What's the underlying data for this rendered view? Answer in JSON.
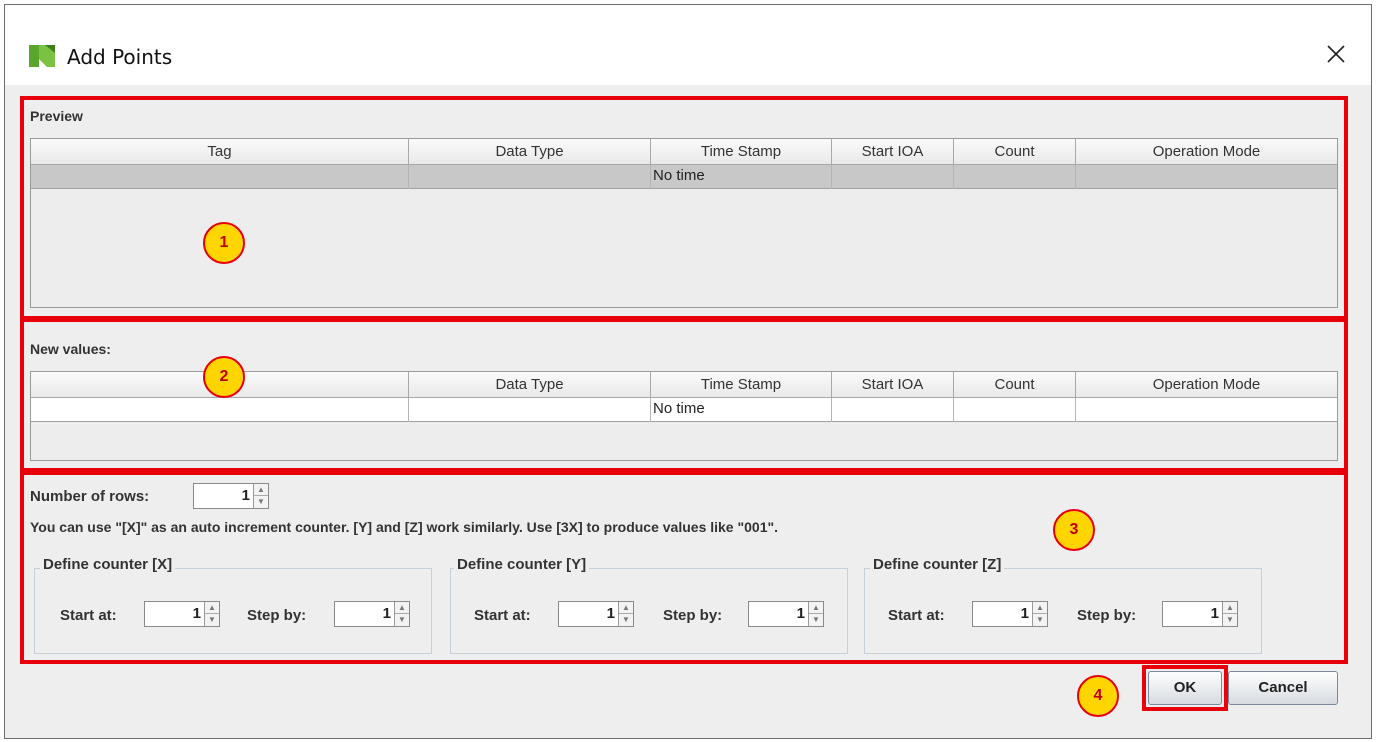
{
  "window": {
    "title": "Add Points",
    "icon": "app-logo-icon",
    "close_icon": "close-icon"
  },
  "preview": {
    "label": "Preview",
    "columns": [
      "Tag",
      "Data Type",
      "Time Stamp",
      "Start IOA",
      "Count",
      "Operation Mode"
    ],
    "row": [
      "",
      "",
      "No time",
      "",
      "",
      ""
    ]
  },
  "new_values": {
    "label": "New values:",
    "columns": [
      "",
      "Data Type",
      "Time Stamp",
      "Start IOA",
      "Count",
      "Operation Mode"
    ],
    "row": [
      "",
      "",
      "No time",
      "",
      "",
      ""
    ]
  },
  "rows": {
    "label": "Number of rows:",
    "value": "1"
  },
  "hint": "You can use \"[X]\" as an auto increment counter. [Y] and [Z] work similarly. Use [3X] to produce values like \"001\".",
  "counters": [
    {
      "title": "Define counter [X]",
      "start_label": "Start at:",
      "start_value": "1",
      "step_label": "Step by:",
      "step_value": "1"
    },
    {
      "title": "Define counter [Y]",
      "start_label": "Start at:",
      "start_value": "1",
      "step_label": "Step by:",
      "step_value": "1"
    },
    {
      "title": "Define counter [Z]",
      "start_label": "Start at:",
      "start_value": "1",
      "step_label": "Step by:",
      "step_value": "1"
    }
  ],
  "buttons": {
    "ok": "OK",
    "cancel": "Cancel"
  },
  "callouts": [
    "1",
    "2",
    "3",
    "4"
  ],
  "colors": {
    "highlight": "#e8000b",
    "callout_fill": "#ffd500",
    "selected_row": "#c8c8c8"
  }
}
